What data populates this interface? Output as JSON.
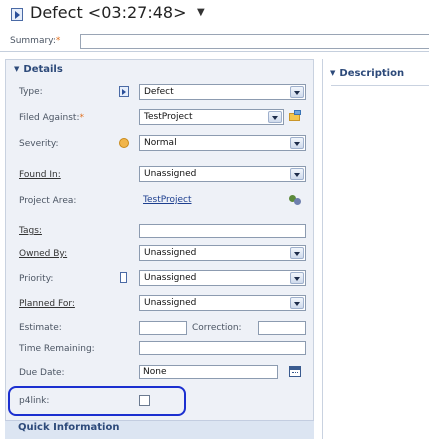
{
  "title": {
    "text": "Defect <03:27:48>",
    "caret": "▼"
  },
  "summary": {
    "label": "Summary:",
    "required_mark": "*",
    "value": ""
  },
  "details": {
    "header": "Details",
    "fields": {
      "type": {
        "label": "Type:",
        "value": "Defect"
      },
      "filed_against": {
        "label": "Filed Against:",
        "required_mark": "*",
        "value": "TestProject"
      },
      "severity": {
        "label": "Severity:",
        "value": "Normal"
      },
      "found_in": {
        "label": "Found In:",
        "value": "Unassigned"
      },
      "project_area": {
        "label": "Project Area:",
        "value": "TestProject"
      },
      "tags": {
        "label": "Tags:",
        "value": ""
      },
      "owned_by": {
        "label": "Owned By:",
        "value": "Unassigned"
      },
      "priority": {
        "label": "Priority:",
        "value": "Unassigned"
      },
      "planned_for": {
        "label": "Planned For:",
        "value": "Unassigned"
      },
      "estimate": {
        "label": "Estimate:",
        "value": ""
      },
      "correction": {
        "label": "Correction:",
        "value": ""
      },
      "time_remaining": {
        "label": "Time Remaining:",
        "value": ""
      },
      "due_date": {
        "label": "Due Date:",
        "value": "None"
      },
      "p4link": {
        "label": "p4link:",
        "checked": false
      }
    }
  },
  "description": {
    "header": "Description"
  },
  "quick_information": {
    "header": "Quick Information"
  },
  "icons": {
    "title": "work-item-icon",
    "type": "defect-type-icon",
    "severity": "severity-normal-icon",
    "priority": "priority-icon",
    "filed_against": "category-icon",
    "project_area": "project-area-icon",
    "due_date": "calendar-icon"
  },
  "colors": {
    "highlight": "#1b2fd0",
    "section_title": "#2d4a7a",
    "required": "#e07020"
  }
}
